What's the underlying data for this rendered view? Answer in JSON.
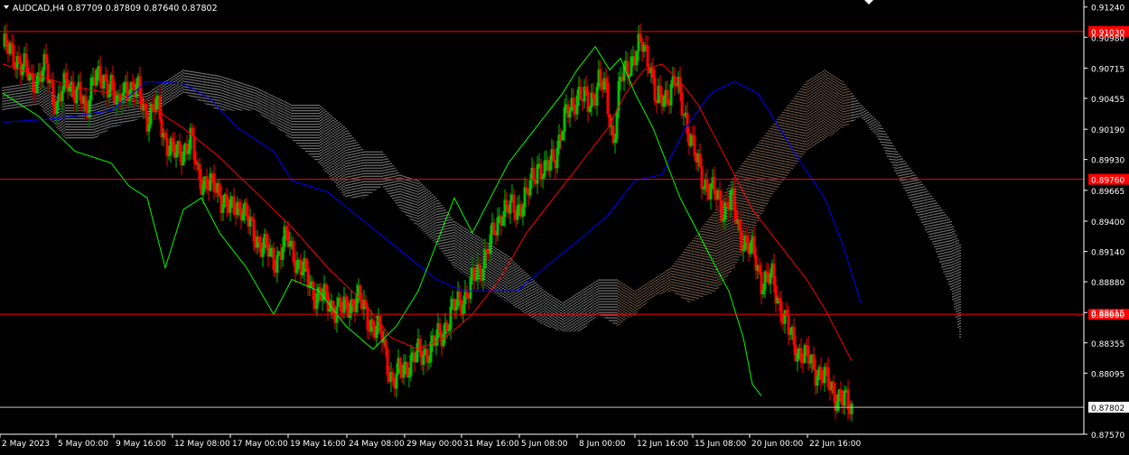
{
  "header": {
    "symbol_label": "AUDCAD,H4",
    "ohlc": [
      "0.87709",
      "0.87809",
      "0.87640",
      "0.87802"
    ]
  },
  "colors": {
    "background": "#000000",
    "grid_text": "#ffffff",
    "bull": "#00c000",
    "bear": "#ff0000",
    "tenkan": "#ff0000",
    "kijun": "#0000ff",
    "chikou": "#00ff00",
    "cloud_bull": "#f4c29c",
    "cloud_bear": "#ffffff",
    "hline": "#ff0000",
    "price_line": "#c0c0c0"
  },
  "chart_data": {
    "type": "candlestick",
    "symbol": "AUDCAD",
    "timeframe": "H4",
    "ylim": [
      0.8757,
      0.913
    ],
    "y_ticks": [
      0.9124,
      0.9098,
      0.90715,
      0.90455,
      0.9019,
      0.8993,
      0.89665,
      0.894,
      0.8914,
      0.8888,
      0.88615,
      0.88355,
      0.88095,
      0.8757
    ],
    "x_ticks": [
      "2 May 2023",
      "5 May 00:00",
      "9 May 16:00",
      "12 May 08:00",
      "17 May 00:00",
      "19 May 16:00",
      "24 May 08:00",
      "29 May 00:00",
      "31 May 16:00",
      "5 Jun 08:00",
      "8 Jun 00:00",
      "12 Jun 16:00",
      "15 Jun 08:00",
      "20 Jun 00:00",
      "22 Jun 16:00"
    ],
    "horizontal_lines": [
      {
        "price": 0.9103,
        "label": "0.91030"
      },
      {
        "price": 0.8976,
        "label": "0.89760"
      },
      {
        "price": 0.886,
        "label": "0.88600"
      }
    ],
    "last_price": {
      "price": 0.87802,
      "label": "0.87802"
    },
    "price_path": [
      [
        0,
        0.909
      ],
      [
        8,
        0.908
      ],
      [
        16,
        0.906
      ],
      [
        24,
        0.907
      ],
      [
        30,
        0.904
      ],
      [
        36,
        0.906
      ],
      [
        42,
        0.905
      ],
      [
        46,
        0.903
      ],
      [
        50,
        0.907
      ],
      [
        55,
        0.9055
      ],
      [
        60,
        0.9062
      ],
      [
        64,
        0.9035
      ],
      [
        68,
        0.9058
      ],
      [
        75,
        0.905
      ],
      [
        80,
        0.903
      ],
      [
        85,
        0.904
      ],
      [
        90,
        0.901
      ],
      [
        96,
        0.8995
      ],
      [
        104,
        0.901
      ],
      [
        108,
        0.898
      ],
      [
        115,
        0.897
      ],
      [
        120,
        0.8965
      ],
      [
        126,
        0.8948
      ],
      [
        132,
        0.8955
      ],
      [
        138,
        0.893
      ],
      [
        144,
        0.892
      ],
      [
        150,
        0.8905
      ],
      [
        157,
        0.8925
      ],
      [
        165,
        0.89
      ],
      [
        172,
        0.888
      ],
      [
        180,
        0.887
      ],
      [
        188,
        0.8862
      ],
      [
        196,
        0.8875
      ],
      [
        203,
        0.8855
      ],
      [
        210,
        0.884
      ],
      [
        216,
        0.88
      ],
      [
        222,
        0.8815
      ],
      [
        230,
        0.8825
      ],
      [
        237,
        0.883
      ],
      [
        245,
        0.885
      ],
      [
        252,
        0.887
      ],
      [
        258,
        0.888
      ],
      [
        264,
        0.89
      ],
      [
        270,
        0.892
      ],
      [
        276,
        0.895
      ],
      [
        283,
        0.895
      ],
      [
        290,
        0.896
      ],
      [
        296,
        0.899
      ],
      [
        300,
        0.898
      ],
      [
        306,
        0.9
      ],
      [
        312,
        0.903
      ],
      [
        318,
        0.905
      ],
      [
        324,
        0.904
      ],
      [
        330,
        0.906
      ],
      [
        334,
        0.905
      ],
      [
        338,
        0.901
      ],
      [
        342,
        0.906
      ],
      [
        348,
        0.908
      ],
      [
        354,
        0.909
      ],
      [
        358,
        0.908
      ],
      [
        362,
        0.904
      ],
      [
        368,
        0.905
      ],
      [
        372,
        0.906
      ],
      [
        378,
        0.903
      ],
      [
        384,
        0.899
      ],
      [
        388,
        0.8975
      ],
      [
        393,
        0.8965
      ],
      [
        399,
        0.895
      ],
      [
        403,
        0.896
      ],
      [
        408,
        0.893
      ],
      [
        412,
        0.892
      ],
      [
        416,
        0.891
      ],
      [
        420,
        0.889
      ],
      [
        426,
        0.889
      ],
      [
        430,
        0.887
      ],
      [
        436,
        0.884
      ],
      [
        440,
        0.883
      ],
      [
        446,
        0.882
      ],
      [
        452,
        0.881
      ],
      [
        457,
        0.88
      ],
      [
        462,
        0.879
      ],
      [
        465,
        0.8785
      ],
      [
        470,
        0.878
      ]
    ],
    "tenkan": [
      [
        0,
        0.9075
      ],
      [
        20,
        0.9065
      ],
      [
        40,
        0.9055
      ],
      [
        60,
        0.905
      ],
      [
        80,
        0.904
      ],
      [
        100,
        0.902
      ],
      [
        120,
        0.8995
      ],
      [
        140,
        0.8965
      ],
      [
        160,
        0.8935
      ],
      [
        180,
        0.89
      ],
      [
        200,
        0.887
      ],
      [
        215,
        0.884
      ],
      [
        230,
        0.883
      ],
      [
        245,
        0.884
      ],
      [
        260,
        0.886
      ],
      [
        275,
        0.889
      ],
      [
        290,
        0.893
      ],
      [
        305,
        0.896
      ],
      [
        320,
        0.899
      ],
      [
        335,
        0.902
      ],
      [
        345,
        0.905
      ],
      [
        355,
        0.907
      ],
      [
        365,
        0.9075
      ],
      [
        375,
        0.906
      ],
      [
        385,
        0.904
      ],
      [
        395,
        0.901
      ],
      [
        405,
        0.898
      ],
      [
        415,
        0.895
      ],
      [
        425,
        0.893
      ],
      [
        435,
        0.891
      ],
      [
        445,
        0.889
      ],
      [
        455,
        0.8865
      ],
      [
        465,
        0.8835
      ],
      [
        470,
        0.882
      ]
    ],
    "kijun": [
      [
        0,
        0.9025
      ],
      [
        30,
        0.9028
      ],
      [
        60,
        0.9035
      ],
      [
        80,
        0.906
      ],
      [
        100,
        0.9058
      ],
      [
        115,
        0.9045
      ],
      [
        130,
        0.902
      ],
      [
        150,
        0.9
      ],
      [
        160,
        0.8975
      ],
      [
        180,
        0.8965
      ],
      [
        200,
        0.894
      ],
      [
        220,
        0.8915
      ],
      [
        240,
        0.889
      ],
      [
        255,
        0.888
      ],
      [
        270,
        0.888
      ],
      [
        285,
        0.888
      ],
      [
        300,
        0.89
      ],
      [
        320,
        0.8925
      ],
      [
        335,
        0.8945
      ],
      [
        350,
        0.8975
      ],
      [
        365,
        0.898
      ],
      [
        378,
        0.902
      ],
      [
        392,
        0.905
      ],
      [
        405,
        0.906
      ],
      [
        418,
        0.905
      ],
      [
        430,
        0.902
      ],
      [
        442,
        0.899
      ],
      [
        455,
        0.896
      ],
      [
        465,
        0.892
      ],
      [
        475,
        0.887
      ]
    ],
    "chikou": [
      [
        0,
        0.905
      ],
      [
        20,
        0.903
      ],
      [
        40,
        0.9
      ],
      [
        60,
        0.899
      ],
      [
        70,
        0.897
      ],
      [
        80,
        0.896
      ],
      [
        90,
        0.89
      ],
      [
        100,
        0.895
      ],
      [
        110,
        0.896
      ],
      [
        120,
        0.893
      ],
      [
        135,
        0.89
      ],
      [
        150,
        0.886
      ],
      [
        160,
        0.889
      ],
      [
        175,
        0.888
      ],
      [
        190,
        0.885
      ],
      [
        205,
        0.883
      ],
      [
        218,
        0.885
      ],
      [
        230,
        0.888
      ],
      [
        240,
        0.892
      ],
      [
        250,
        0.896
      ],
      [
        260,
        0.893
      ],
      [
        270,
        0.896
      ],
      [
        280,
        0.899
      ],
      [
        290,
        0.901
      ],
      [
        300,
        0.903
      ],
      [
        310,
        0.905
      ],
      [
        318,
        0.907
      ],
      [
        328,
        0.909
      ],
      [
        336,
        0.907
      ],
      [
        342,
        0.908
      ],
      [
        350,
        0.905
      ],
      [
        360,
        0.902
      ],
      [
        365,
        0.9
      ],
      [
        375,
        0.896
      ],
      [
        385,
        0.893
      ],
      [
        395,
        0.89
      ],
      [
        402,
        0.888
      ],
      [
        410,
        0.884
      ],
      [
        415,
        0.88
      ],
      [
        420,
        0.879
      ]
    ],
    "cloud": [
      [
        0,
        0.9055,
        0.9035
      ],
      [
        20,
        0.906,
        0.904
      ],
      [
        35,
        0.904,
        0.901
      ],
      [
        50,
        0.904,
        0.901
      ],
      [
        60,
        0.9045,
        0.902
      ],
      [
        80,
        0.905,
        0.903
      ],
      [
        100,
        0.907,
        0.905
      ],
      [
        120,
        0.9065,
        0.9035
      ],
      [
        140,
        0.9055,
        0.9035
      ],
      [
        160,
        0.904,
        0.901
      ],
      [
        175,
        0.904,
        0.899
      ],
      [
        190,
        0.902,
        0.896
      ],
      [
        200,
        0.9,
        0.896
      ],
      [
        210,
        0.9,
        0.897
      ],
      [
        220,
        0.898,
        0.895
      ],
      [
        230,
        0.8975,
        0.8935
      ],
      [
        240,
        0.896,
        0.892
      ],
      [
        250,
        0.894,
        0.89
      ],
      [
        260,
        0.893,
        0.889
      ],
      [
        270,
        0.892,
        0.888
      ],
      [
        280,
        0.891,
        0.887
      ],
      [
        290,
        0.8895,
        0.886
      ],
      [
        300,
        0.888,
        0.885
      ],
      [
        310,
        0.887,
        0.8845
      ],
      [
        320,
        0.888,
        0.8845
      ],
      [
        330,
        0.889,
        0.886
      ],
      [
        340,
        0.889,
        0.885
      ],
      [
        350,
        0.888,
        0.886
      ],
      [
        360,
        0.889,
        0.8875
      ],
      [
        370,
        0.89,
        0.888
      ],
      [
        380,
        0.892,
        0.887
      ],
      [
        395,
        0.895,
        0.888
      ],
      [
        405,
        0.898,
        0.89
      ],
      [
        415,
        0.9,
        0.893
      ],
      [
        425,
        0.902,
        0.896
      ],
      [
        435,
        0.904,
        0.898
      ],
      [
        445,
        0.906,
        0.9
      ],
      [
        455,
        0.907,
        0.901
      ],
      [
        465,
        0.906,
        0.902
      ],
      [
        475,
        0.904,
        0.903
      ],
      [
        485,
        0.9025,
        0.901
      ],
      [
        495,
        0.9,
        0.898
      ],
      [
        505,
        0.898,
        0.895
      ],
      [
        515,
        0.896,
        0.892
      ],
      [
        525,
        0.894,
        0.888
      ],
      [
        530,
        0.892,
        0.884
      ]
    ]
  }
}
